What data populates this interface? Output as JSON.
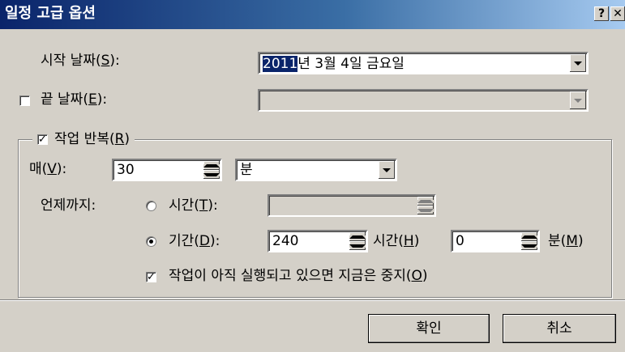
{
  "window": {
    "title": "일정 고급 옵션",
    "help_button": "?",
    "close_button": "✕"
  },
  "start_date": {
    "label_prefix": "시작 날짜(",
    "label_key": "S",
    "label_suffix": "):",
    "value_highlight": "2011",
    "value_rest": "년  3월  4일 금요일"
  },
  "end_date": {
    "checked": false,
    "label_prefix": "끝 날짜(",
    "label_key": "E",
    "label_suffix": "):",
    "value": ""
  },
  "repeat": {
    "checked": true,
    "label_prefix": "작업 반복(",
    "label_key": "R",
    "label_suffix": ")",
    "every_label_prefix": "매(",
    "every_label_key": "V",
    "every_label_suffix": "):",
    "every_value": "30",
    "unit_selected": "분",
    "until_label": "언제까지:",
    "time_option": {
      "selected": false,
      "label_prefix": "시간(",
      "label_key": "T",
      "label_suffix": "):",
      "value": ""
    },
    "duration_option": {
      "selected": true,
      "label_prefix": "기간(",
      "label_key": "D",
      "label_suffix": "):",
      "hours_value": "240",
      "hours_label_prefix": "시간(",
      "hours_label_key": "H",
      "hours_label_suffix": ")",
      "minutes_value": "0",
      "minutes_label_prefix": "분(",
      "minutes_label_key": "M",
      "minutes_label_suffix": ")"
    },
    "stop_if_running": {
      "checked": true,
      "label_prefix": "작업이 아직 실행되고 있으면 지금은 중지(",
      "label_key": "O",
      "label_suffix": ")"
    }
  },
  "buttons": {
    "ok": "확인",
    "cancel": "취소"
  }
}
